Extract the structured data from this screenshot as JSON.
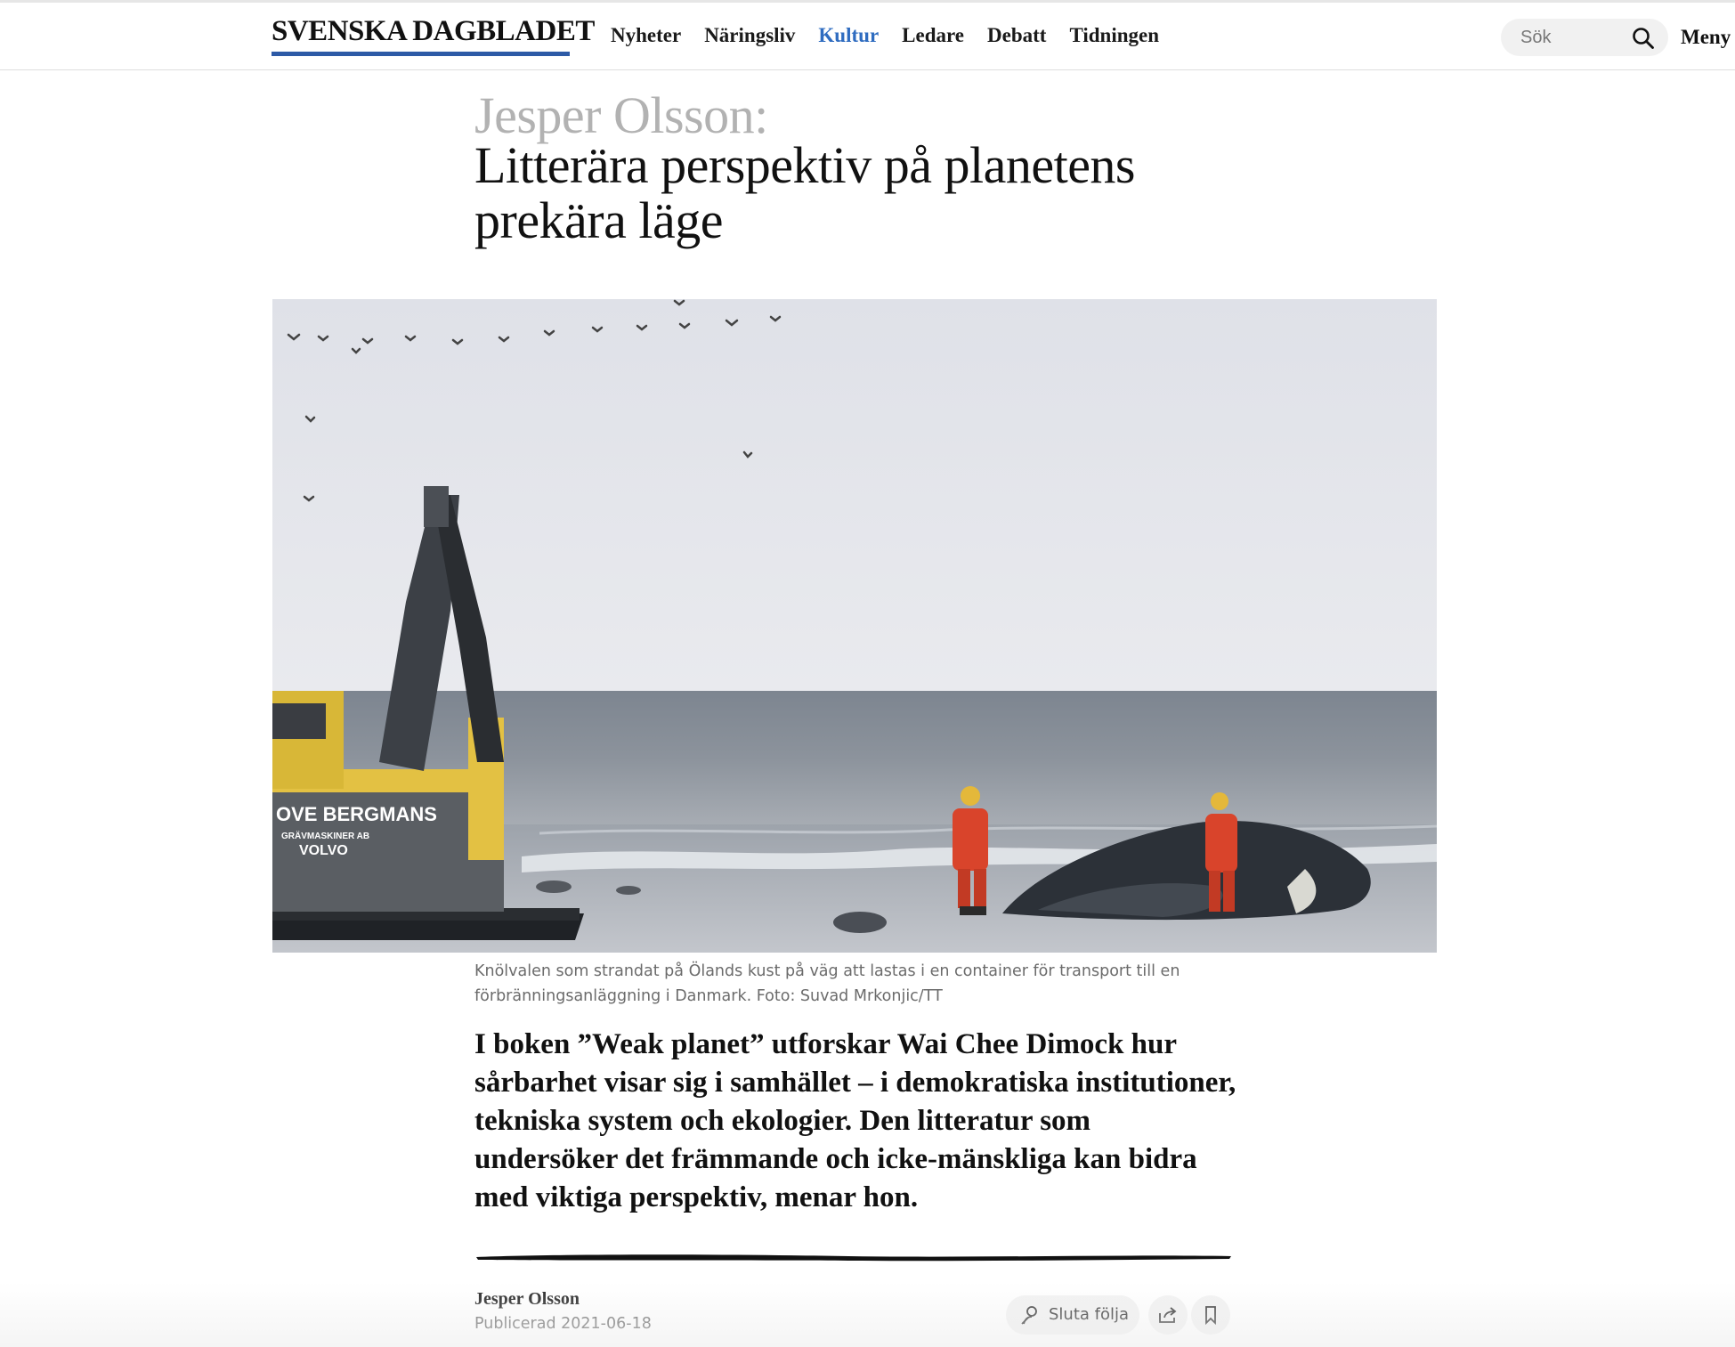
{
  "header": {
    "logo": "SVENSKA DAGBLADET",
    "nav": [
      {
        "label": "Nyheter",
        "active": false
      },
      {
        "label": "Näringsliv",
        "active": false
      },
      {
        "label": "Kultur",
        "active": true
      },
      {
        "label": "Ledare",
        "active": false
      },
      {
        "label": "Debatt",
        "active": false
      },
      {
        "label": "Tidningen",
        "active": false
      }
    ],
    "search_placeholder": "Sök",
    "menu_label": "Meny",
    "accent_color": "#2f6cc0",
    "logo_underline_color": "#2d5aa6"
  },
  "article": {
    "kicker": "Jesper Olsson:",
    "title": "Litterära perspektiv på planetens prekära läge",
    "image_caption": "Knölvalen som strandat på Ölands kust på väg att lastas i en container för transport till en förbränningsanläggning i Danmark. Foto: Suvad Mrkonjic/TT",
    "image_text": {
      "excavator_brand": "OVE BERGMANS",
      "excavator_sub": "GRÄVMASKINER AB",
      "excavator_make": "VOLVO"
    },
    "lead": "I boken ”Weak planet” utforskar Wai Chee Dimock hur sårbarhet visar sig i samhället – i demokratiska institutioner, tekniska system och ekologier. Den litteratur som undersöker det främmande och icke-mänskliga kan bidra med viktiga perspektiv, menar hon.",
    "author": "Jesper Olsson",
    "published": "Publicerad 2021-06-18"
  },
  "actions": {
    "follow_label": "Sluta följa",
    "share_icon": "share-icon",
    "bookmark_icon": "bookmark-icon"
  }
}
